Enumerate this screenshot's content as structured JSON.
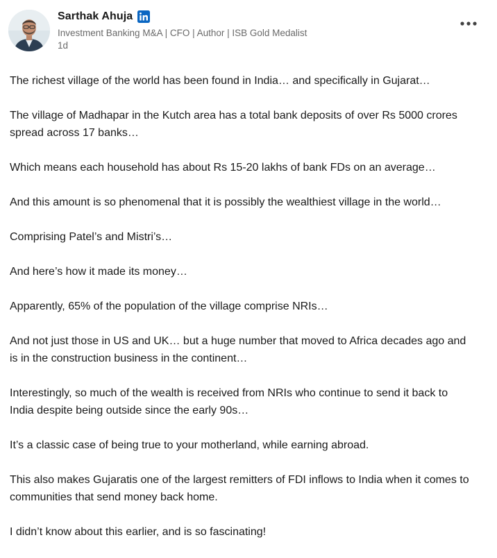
{
  "post": {
    "author": {
      "name": "Sarthak Ahuja",
      "headline": "Investment Banking M&A | CFO | Author | ISB Gold Medalist",
      "time": "1d",
      "badge_icon": "linkedin-icon",
      "avatar_icon": "avatar",
      "brand_color": "#0a66c2"
    },
    "more_icon": "more-options-icon",
    "paragraphs": [
      "The richest village of the world has been found in India… and specifically in Gujarat…",
      "The village of Madhapar in the Kutch area has a total bank deposits of over Rs 5000 crores\nspread across 17 banks…",
      "Which means each household has about Rs 15-20 lakhs of bank FDs on an average…",
      "And this amount is so phenomenal that it is possibly the wealthiest village in the world…",
      "Comprising Patel’s and Mistri’s…",
      "And here’s how it made its money…",
      "Apparently, 65% of the population of the village comprise NRIs…",
      "And not just those in US and UK… but a huge number that moved to Africa decades ago and\nis in the construction business in the continent…",
      "Interestingly, so much of the wealth is received from NRIs who continue to send it back to\nIndia despite being outside since the early 90s…",
      "It’s a classic case of being true to your motherland, while earning abroad.",
      "This also makes Gujaratis one of the largest remitters of FDI inflows to India when it comes to\ncommunities that send money back home.",
      "I didn’t know about this earlier, and is so fascinating!"
    ]
  }
}
